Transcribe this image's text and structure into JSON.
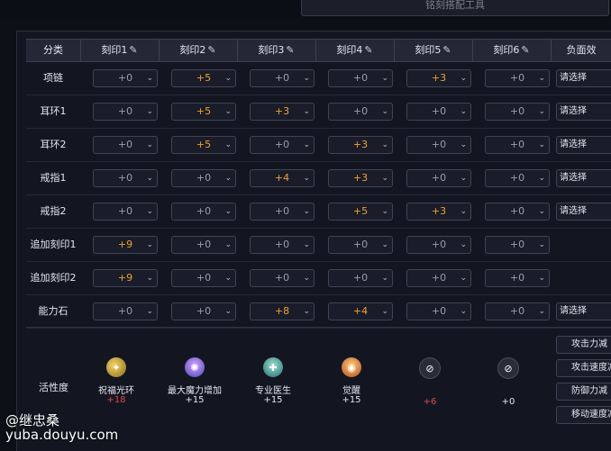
{
  "top_bar": {
    "text": "铭刻搭配工具"
  },
  "header": {
    "category": "分类",
    "columns": [
      "刻印1",
      "刻印2",
      "刻印3",
      "刻印4",
      "刻印5",
      "刻印6"
    ],
    "negative": "负面效"
  },
  "rows": [
    {
      "label": "项链",
      "values": [
        "+0",
        "+5",
        "+0",
        "+0",
        "+3",
        "+0"
      ],
      "negative": "请选择"
    },
    {
      "label": "耳环1",
      "values": [
        "+0",
        "+5",
        "+3",
        "+0",
        "+0",
        "+0"
      ],
      "negative": "请选择"
    },
    {
      "label": "耳环2",
      "values": [
        "+0",
        "+5",
        "+0",
        "+3",
        "+0",
        "+0"
      ],
      "negative": "请选择"
    },
    {
      "label": "戒指1",
      "values": [
        "+0",
        "+0",
        "+4",
        "+3",
        "+0",
        "+0"
      ],
      "negative": "请选择"
    },
    {
      "label": "戒指2",
      "values": [
        "+0",
        "+0",
        "+0",
        "+5",
        "+3",
        "+0"
      ],
      "negative": "请选择"
    },
    {
      "label": "追加刻印1",
      "values": [
        "+9",
        "+0",
        "+0",
        "+0",
        "+0",
        "+0"
      ],
      "negative": null
    },
    {
      "label": "追加刻印2",
      "values": [
        "+9",
        "+0",
        "+0",
        "+0",
        "+0",
        "+0"
      ],
      "negative": null
    },
    {
      "label": "能力石",
      "values": [
        "+0",
        "+0",
        "+8",
        "+4",
        "+0",
        "+0"
      ],
      "negative": "请选择"
    }
  ],
  "activity": {
    "label": "活性度",
    "skills": [
      {
        "icon": "blessing-aura-icon",
        "name": "祝福光环",
        "value": "+18",
        "color": "red"
      },
      {
        "icon": "max-mana-icon",
        "name": "最大魔力增加",
        "value": "+15",
        "color": "white"
      },
      {
        "icon": "expert-doctor-icon",
        "name": "专业医生",
        "value": "+15",
        "color": "white"
      },
      {
        "icon": "awakening-icon",
        "name": "觉醒",
        "value": "+15",
        "color": "white"
      },
      {
        "icon": "empty-slot-icon",
        "name": "",
        "value": "+6",
        "color": "red"
      },
      {
        "icon": "empty-slot-icon",
        "name": "",
        "value": "+0",
        "color": "white"
      }
    ]
  },
  "negative_buttons": [
    "攻击力减",
    "攻击速度减",
    "防御力减",
    "移动速度减"
  ],
  "watermark": {
    "handle": "@继忠桑",
    "site": "yuba.douyu.com"
  },
  "colors": {
    "highlight": "#f0a030",
    "red": "#e04848",
    "background": "#131621"
  }
}
